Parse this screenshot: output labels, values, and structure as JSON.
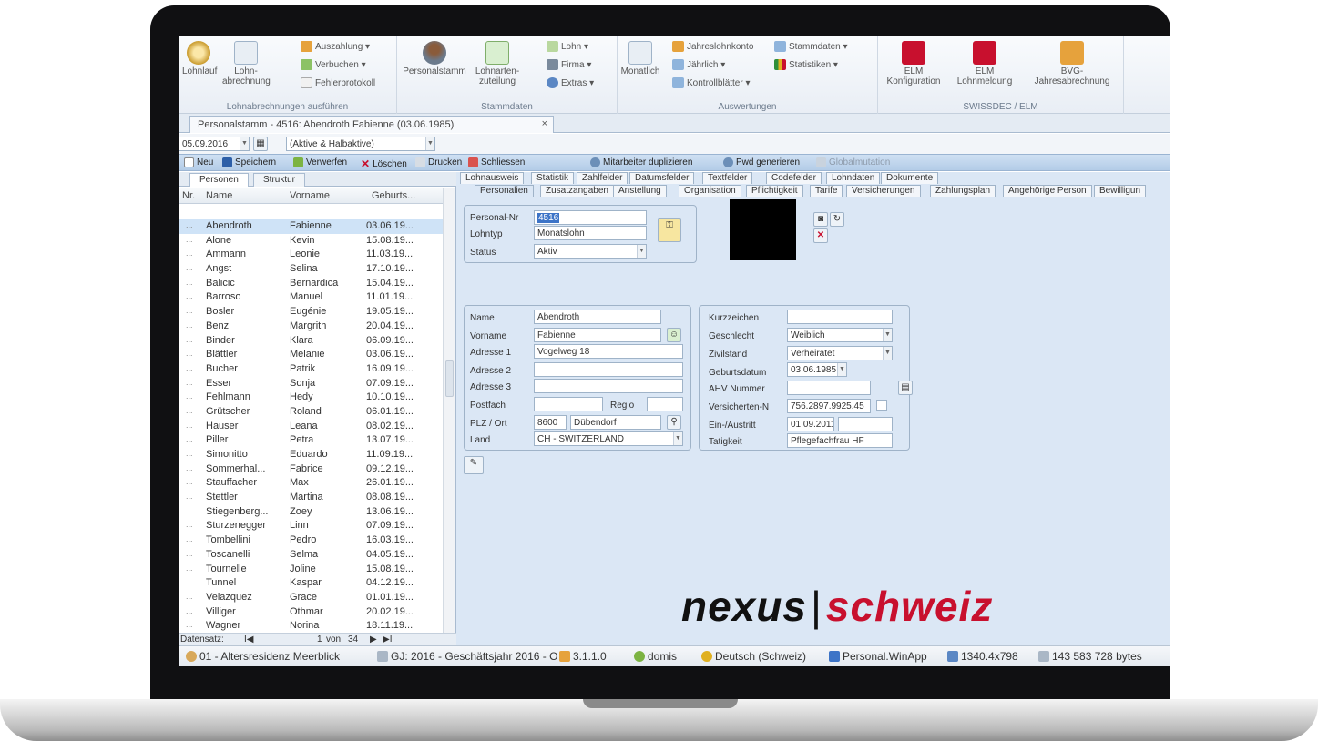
{
  "ribbon": {
    "group1": {
      "label": "Lohnabrechnungen ausführen",
      "btn1": "Lohnlauf",
      "btn2a": "Lohn-",
      "btn2b": "abrechnung",
      "s1": "Auszahlung ▾",
      "s2": "Verbuchen ▾",
      "s3": "Fehlerprotokoll"
    },
    "group2": {
      "label": "Stammdaten",
      "btn1": "Personalstamm",
      "btn2a": "Lohnarten-",
      "btn2b": "zuteilung",
      "s1": "Lohn ▾",
      "s2": "Firma ▾",
      "s3": "Extras ▾"
    },
    "group3": {
      "label": "Auswertungen",
      "btn1": "Monatlich",
      "s1": "Jahreslohnkonto",
      "s2": "Jährlich ▾",
      "s3": "Kontrollblätter ▾",
      "s4": "Stammdaten ▾",
      "s5": "Statistiken ▾"
    },
    "group4": {
      "label": "SWISSDEC / ELM",
      "btn1a": "ELM",
      "btn1b": "Konfiguration",
      "btn2a": "ELM",
      "btn2b": "Lohnmeldung",
      "btn3a": "BVG-",
      "btn3b": "Jahresabrechnung"
    }
  },
  "doctab": {
    "title": "Personalstamm - 4516: Abendroth Fabienne (03.06.1985)",
    "close": "×"
  },
  "filter": {
    "date": "05.09.2016",
    "status": "(Aktive & Halbaktive)"
  },
  "toolbar": {
    "neu": "Neu",
    "speichern": "Speichern",
    "verwerfen": "Verwerfen",
    "loeschen": "Löschen",
    "drucken": "Drucken",
    "schliessen": "Schliessen",
    "duplizieren": "Mitarbeiter duplizieren",
    "pwd": "Pwd generieren",
    "globalmutation": "Globalmutation"
  },
  "left": {
    "tab1": "Personen",
    "tab2": "Struktur",
    "headers": {
      "nr": "Nr.",
      "name": "Name",
      "vorname": "Vorname",
      "geburts": "Geburts..."
    },
    "rows": [
      {
        "name": "Abendroth",
        "vorname": "Fabienne",
        "date": "03.06.19..."
      },
      {
        "name": "Alone",
        "vorname": "Kevin",
        "date": "15.08.19..."
      },
      {
        "name": "Ammann",
        "vorname": "Leonie",
        "date": "11.03.19..."
      },
      {
        "name": "Angst",
        "vorname": "Selina",
        "date": "17.10.19..."
      },
      {
        "name": "Balicic",
        "vorname": "Bernardica",
        "date": "15.04.19..."
      },
      {
        "name": "Barroso",
        "vorname": "Manuel",
        "date": "11.01.19..."
      },
      {
        "name": "Bosler",
        "vorname": "Eugénie",
        "date": "19.05.19..."
      },
      {
        "name": "Benz",
        "vorname": "Margrith",
        "date": "20.04.19..."
      },
      {
        "name": "Binder",
        "vorname": "Klara",
        "date": "06.09.19..."
      },
      {
        "name": "Blättler",
        "vorname": "Melanie",
        "date": "03.06.19..."
      },
      {
        "name": "Bucher",
        "vorname": "Patrik",
        "date": "16.09.19..."
      },
      {
        "name": "Esser",
        "vorname": "Sonja",
        "date": "07.09.19..."
      },
      {
        "name": "Fehlmann",
        "vorname": "Hedy",
        "date": "10.10.19..."
      },
      {
        "name": "Grütscher",
        "vorname": "Roland",
        "date": "06.01.19..."
      },
      {
        "name": "Hauser",
        "vorname": "Leana",
        "date": "08.02.19..."
      },
      {
        "name": "Piller",
        "vorname": "Petra",
        "date": "13.07.19..."
      },
      {
        "name": "Simonitto",
        "vorname": "Eduardo",
        "date": "11.09.19..."
      },
      {
        "name": "Sommerhal...",
        "vorname": "Fabrice",
        "date": "09.12.19..."
      },
      {
        "name": "Stauffacher",
        "vorname": "Max",
        "date": "26.01.19..."
      },
      {
        "name": "Stettler",
        "vorname": "Martina",
        "date": "08.08.19..."
      },
      {
        "name": "Stiegenberg...",
        "vorname": "Zoey",
        "date": "13.06.19..."
      },
      {
        "name": "Sturzenegger",
        "vorname": "Linn",
        "date": "07.09.19..."
      },
      {
        "name": "Tombellini",
        "vorname": "Pedro",
        "date": "16.03.19..."
      },
      {
        "name": "Toscanelli",
        "vorname": "Selma",
        "date": "04.05.19..."
      },
      {
        "name": "Tournelle",
        "vorname": "Joline",
        "date": "15.08.19..."
      },
      {
        "name": "Tunnel",
        "vorname": "Kaspar",
        "date": "04.12.19..."
      },
      {
        "name": "Velazquez",
        "vorname": "Grace",
        "date": "01.01.19..."
      },
      {
        "name": "Villiger",
        "vorname": "Othmar",
        "date": "20.02.19..."
      },
      {
        "name": "Wagner",
        "vorname": "Norina",
        "date": "18.11.19..."
      }
    ],
    "nav": {
      "label": "Datensatz:",
      "first": "I◀",
      "page": "1",
      "von": "von",
      "total": "34",
      "next": "▶",
      "last": "▶I"
    }
  },
  "tabs1": [
    "Lohnausweis",
    "Statistik",
    "Zahlfelder",
    "Datumsfelder",
    "Textfelder",
    "Codefelder",
    "Lohndaten",
    "Dokumente"
  ],
  "tabs2": [
    "Personalien",
    "Zusatzangaben",
    "Anstellung",
    "Organisation",
    "Pflichtigkeit",
    "Tarife",
    "Versicherungen",
    "Zahlungsplan",
    "Angehörige Person",
    "Bewilligun"
  ],
  "form": {
    "personalnr_label": "Personal-Nr",
    "personalnr": "4516",
    "lohntyp_label": "Lohntyp",
    "lohntyp": "Monatslohn",
    "status_label": "Status",
    "status": "Aktiv",
    "name_label": "Name",
    "name": "Abendroth",
    "vorname_label": "Vorname",
    "vorname": "Fabienne",
    "adresse1_label": "Adresse 1",
    "adresse1": "Vogelweg 18",
    "adresse2_label": "Adresse 2",
    "adresse3_label": "Adresse 3",
    "postfach_label": "Postfach",
    "regio_label": "Regio",
    "plz_label": "PLZ / Ort",
    "plz": "8600",
    "ort": "Dübendorf",
    "land_label": "Land",
    "land": "CH - SWITZERLAND",
    "kurz_label": "Kurzzeichen",
    "geschlecht_label": "Geschlecht",
    "geschlecht": "Weiblich",
    "zivil_label": "Zivilstand",
    "zivil": "Verheiratet",
    "geburt_label": "Geburtsdatum",
    "geburt": "03.06.1985",
    "ahv_label": "AHV Nummer",
    "versnr_label": "Versicherten-N",
    "versnr": "756.2897.9925.45",
    "einaus_label": "Ein-/Austritt",
    "eintritt": "01.09.2011",
    "taetig_label": "Tatigkeit",
    "taetig": "Pflegefachfrau HF"
  },
  "logo": {
    "part1": "nexus",
    "sep": "|",
    "part2": "schweiz"
  },
  "status": {
    "mandant": "01 - Altersresidenz Meerblick",
    "gj": "GJ: 2016 - Geschäftsjahr 2016 - O",
    "version": "3.1.1.0",
    "user": "domis",
    "lang": "Deutsch (Schweiz)",
    "app": "Personal.WinApp",
    "res": "1340.4x798",
    "bytes": "143 583 728 bytes"
  },
  "colors": {
    "accent_red": "#c8102e",
    "toolbar_blue": "#b3cce7",
    "panel_blue": "#dbe7f5"
  }
}
